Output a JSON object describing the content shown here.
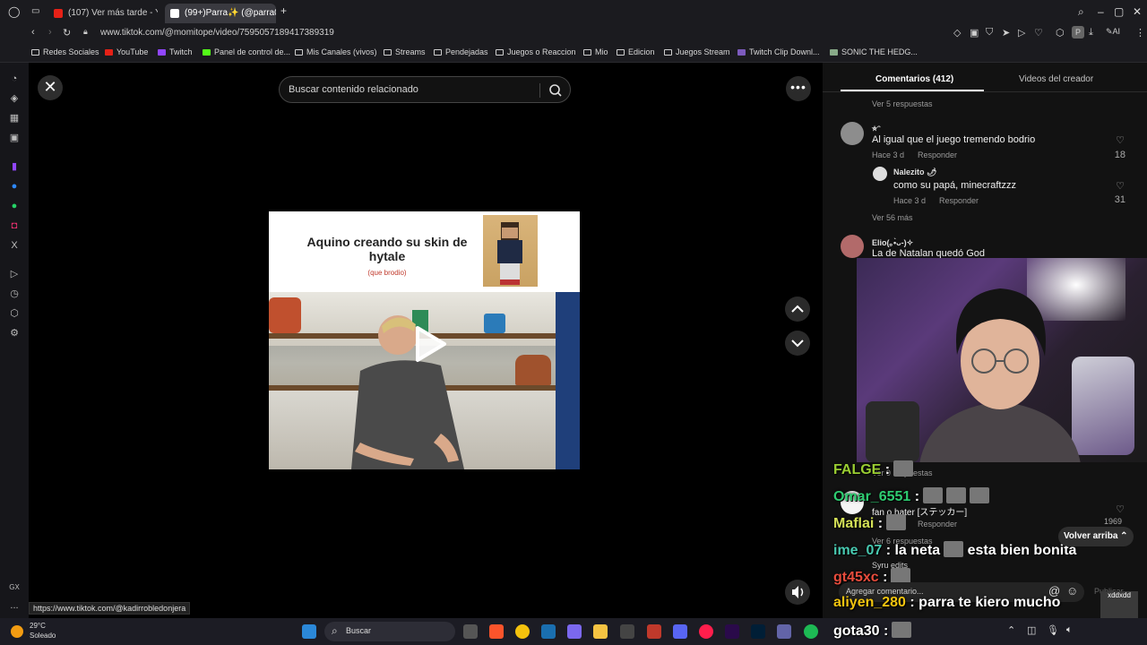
{
  "browser": {
    "tabs": [
      {
        "label": "(107) Ver más tarde - YouT",
        "icon": "youtube-icon",
        "color": "#e62117"
      },
      {
        "label": "(99+)Parra✨ (@parra0fic",
        "icon": "tiktok-icon",
        "color": "#ffffff"
      }
    ],
    "new_tab": "+",
    "url": "www.tiktok.com/@momitope/video/7595057189417389319",
    "status_link": "https://www.tiktok.com/@kadirrobledonjera"
  },
  "bookmarks": [
    {
      "label": "Redes Sociales",
      "icon": "folder-icon"
    },
    {
      "label": "YouTube",
      "icon": "youtube-icon"
    },
    {
      "label": "Twitch",
      "icon": "twitch-icon"
    },
    {
      "label": "Panel de control de...",
      "icon": "kick-icon"
    },
    {
      "label": "Mis Canales (vivos)",
      "icon": "folder-icon"
    },
    {
      "label": "Streams",
      "icon": "folder-icon"
    },
    {
      "label": "Pendejadas",
      "icon": "folder-icon"
    },
    {
      "label": "Juegos o Reaccion",
      "icon": "folder-icon"
    },
    {
      "label": "Mio",
      "icon": "folder-icon"
    },
    {
      "label": "Edicion",
      "icon": "folder-icon"
    },
    {
      "label": "Juegos Stream",
      "icon": "folder-icon"
    },
    {
      "label": "Twitch Clip Downl...",
      "icon": "clip-icon"
    },
    {
      "label": "SONIC THE HEDG...",
      "icon": "image-icon"
    }
  ],
  "sidebar": {
    "bottom_label": "GX",
    "more": "..."
  },
  "search": {
    "placeholder": "Buscar contenido relacionado"
  },
  "video": {
    "caption_title": "Aquino creando su skin de hytale",
    "caption_sub": "(que brodio)"
  },
  "comments_panel": {
    "tab_comments": "Comentarios (412)",
    "tab_creator": "Videos del creador",
    "view_replies_top": "Ver 5 respuestas",
    "comment1": {
      "user": "⭐︎ᵔ",
      "text": "Al igual que el juego tremendo bodrio",
      "time": "Hace 3 d",
      "reply": "Responder",
      "likes": "18"
    },
    "comment2": {
      "user": "Nalezito 🌶",
      "text": "como su papá, minecraftzzz",
      "time": "Hace 3 d",
      "reply": "Responder",
      "likes": "31"
    },
    "view_more": "Ver 56 más",
    "comment3": {
      "user": "Elio(｡•̀ᴗ-)✧",
      "text": "La de Natalan quedó God"
    },
    "hidden_replies": "Ver 9 respuestas",
    "comment4": {
      "text": "fan o hater [ステッカー]",
      "reply": "Responder",
      "likes": "1969"
    },
    "hidden_replies2": "Ver 6 respuestas",
    "comment5_user": "Syru edits",
    "volver_arriba": "Volver arriba",
    "add_comment": "Agregar comentario...",
    "publish": "Publicar"
  },
  "chat": [
    {
      "user": "FALGE",
      "msg": "",
      "color": "#9acd32"
    },
    {
      "user": "Omar_6551",
      "msg": "",
      "color": "#2ecc71"
    },
    {
      "user": "Maflai",
      "msg": "",
      "color": "#d4e157"
    },
    {
      "user": "ime_07",
      "msg": "la neta",
      "msg2": "esta bien bonita",
      "color": "#48c9b0"
    },
    {
      "user": "gt45xc",
      "msg": "",
      "color": "#e74c3c"
    },
    {
      "user": "aliyen_280",
      "msg": "parra te kiero mucho",
      "color": "#f1c40f"
    },
    {
      "user": "gota30",
      "msg": "",
      "color": "#ffffff"
    }
  ],
  "chat_badge": "xddxdd",
  "taskbar": {
    "weather_temp": "29°C",
    "weather_desc": "Soleado",
    "search_label": "Buscar"
  }
}
